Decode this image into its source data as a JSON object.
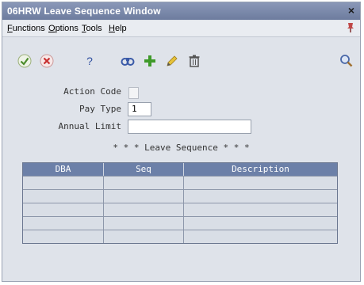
{
  "window": {
    "title": "06HRW  Leave Sequence Window",
    "close_glyph": "×"
  },
  "menu": {
    "items": [
      {
        "accel": "F",
        "rest": "unctions"
      },
      {
        "accel": "O",
        "rest": "ptions"
      },
      {
        "accel": "T",
        "rest": "ools"
      },
      {
        "accel": "H",
        "rest": "elp"
      }
    ]
  },
  "toolbar": {
    "help_glyph": "?",
    "icons": [
      "checkmark-icon",
      "cancel-icon",
      "help-icon",
      "binoculars-icon",
      "add-icon",
      "pencil-icon",
      "trash-icon",
      "search-icon"
    ]
  },
  "form": {
    "action_code_label": "Action Code",
    "pay_type_label": "Pay Type",
    "pay_type_value": "1",
    "annual_limit_label": "Annual Limit",
    "annual_limit_value": "",
    "section_title": "* * *  Leave Sequence  * * *"
  },
  "grid": {
    "columns": [
      "DBA",
      "Seq",
      "Description"
    ],
    "rows": [
      [
        "",
        "",
        ""
      ],
      [
        "",
        "",
        ""
      ],
      [
        "",
        "",
        ""
      ],
      [
        "",
        "",
        ""
      ],
      [
        "",
        "",
        ""
      ]
    ]
  },
  "colors": {
    "title_bar": "#7685a8",
    "grid_header": "#6c80a8",
    "window_bg": "#dfe3ea"
  }
}
